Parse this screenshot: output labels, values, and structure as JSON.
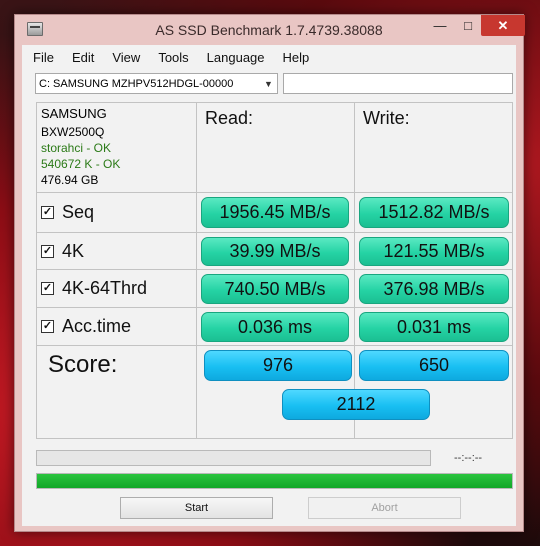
{
  "window": {
    "title": "AS SSD Benchmark 1.7.4739.38088",
    "controls": {
      "minimize": "—",
      "maximize": "□",
      "close": "✕"
    }
  },
  "menu": [
    "File",
    "Edit",
    "View",
    "Tools",
    "Language",
    "Help"
  ],
  "drive_select": {
    "value": "C: SAMSUNG MZHPV512HDGL-00000"
  },
  "drive_info": {
    "vendor": "SAMSUNG",
    "firmware": "BXW2500Q",
    "driver_status": "storahci - OK",
    "alignment_status": "540672 K - OK",
    "capacity": "476.94 GB"
  },
  "columns": {
    "read": "Read:",
    "write": "Write:"
  },
  "tests": [
    {
      "label": "Seq",
      "checked": true,
      "read": "1956.45 MB/s",
      "write": "1512.82 MB/s"
    },
    {
      "label": "4K",
      "checked": true,
      "read": "39.99 MB/s",
      "write": "121.55 MB/s"
    },
    {
      "label": "4K-64Thrd",
      "checked": true,
      "read": "740.50 MB/s",
      "write": "376.98 MB/s"
    },
    {
      "label": "Acc.time",
      "checked": true,
      "read": "0.036 ms",
      "write": "0.031 ms"
    }
  ],
  "score": {
    "label": "Score:",
    "read": "976",
    "write": "650",
    "total": "2112"
  },
  "timer": "--:--:--",
  "progress": {
    "test_progress": 0,
    "overall_progress": 1.0
  },
  "buttons": {
    "start": "Start",
    "abort": "Abort"
  },
  "colors": {
    "result_green": "#25d3a4",
    "score_blue": "#18bff2",
    "progress_green": "#12a728",
    "close_red": "#c7372f"
  }
}
